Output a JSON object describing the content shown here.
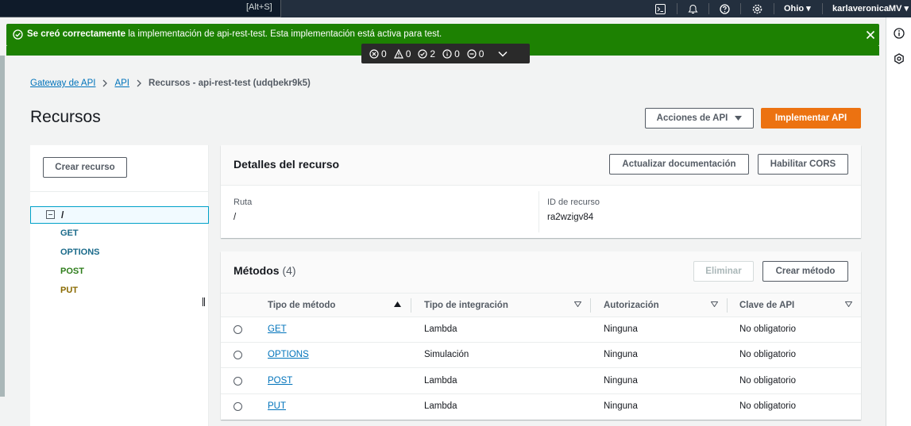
{
  "topnav": {
    "shortcut": "[Alt+S]",
    "region": "Ohio",
    "user": "karlaveronicaMV"
  },
  "flash": {
    "bold": "Se creó correctamente",
    "text": " la implementación de api-rest-test. Esta implementación está activa para test."
  },
  "devbar": {
    "errors": "0",
    "warnings": "0",
    "passed": "2",
    "info": "0",
    "muted": "0"
  },
  "breadcrumb": {
    "item1": "Gateway de API",
    "item2": "API",
    "current": "Recursos - api-rest-test (udqbekr9k5)"
  },
  "page": {
    "title": "Recursos",
    "actions_label": "Acciones de API",
    "deploy_label": "Implementar API"
  },
  "resources": {
    "create_label": "Crear recurso",
    "root": "/",
    "methods": [
      "GET",
      "OPTIONS",
      "POST",
      "PUT"
    ]
  },
  "details": {
    "title": "Detalles del recurso",
    "update_docs_label": "Actualizar documentación",
    "cors_label": "Habilitar CORS",
    "path_label": "Ruta",
    "path_value": "/",
    "id_label": "ID de recurso",
    "id_value": "ra2wzigv84"
  },
  "methods": {
    "title": "Métodos",
    "count": "(4)",
    "delete_label": "Eliminar",
    "create_label": "Crear método",
    "columns": [
      "Tipo de método",
      "Tipo de integración",
      "Autorización",
      "Clave de API"
    ],
    "rows": [
      {
        "method": "GET",
        "integration": "Lambda",
        "auth": "Ninguna",
        "key": "No obligatorio"
      },
      {
        "method": "OPTIONS",
        "integration": "Simulación",
        "auth": "Ninguna",
        "key": "No obligatorio"
      },
      {
        "method": "POST",
        "integration": "Lambda",
        "auth": "Ninguna",
        "key": "No obligatorio"
      },
      {
        "method": "PUT",
        "integration": "Lambda",
        "auth": "Ninguna",
        "key": "No obligatorio"
      }
    ]
  },
  "colors": {
    "success": "#1d8102",
    "primary": "#ec7211",
    "link": "#0073bb",
    "nav": "#232f3e"
  }
}
